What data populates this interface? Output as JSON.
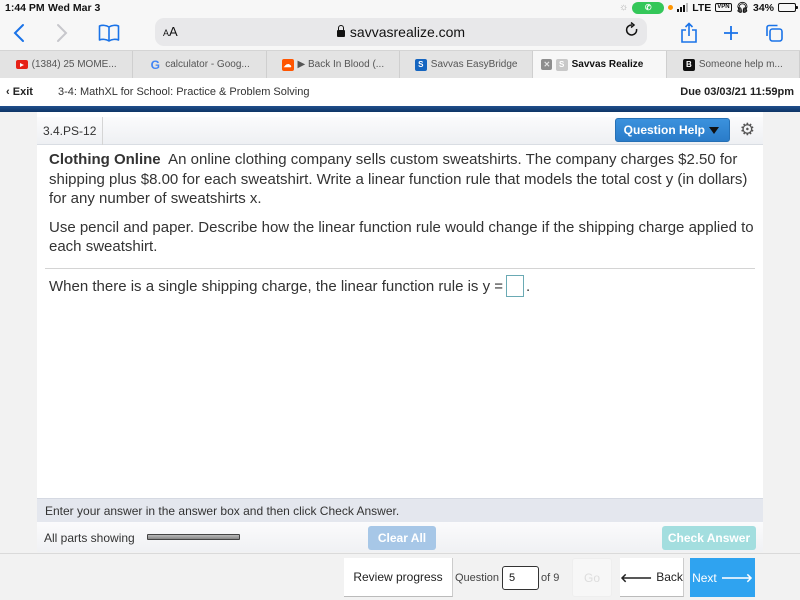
{
  "status_bar": {
    "time": "1:44 PM",
    "date": "Wed Mar 3",
    "network": "LTE",
    "vpn_label": "VPN",
    "battery_percent_label": "34%",
    "battery_level": 0.34,
    "call_icon": "phone-icon"
  },
  "browser": {
    "text_size_label": "AA",
    "url": "savvasrealize.com",
    "icons": {
      "back": "chevron-left-icon",
      "forward": "chevron-right-icon",
      "bookmarks": "book-icon",
      "reload": "reload-icon",
      "share": "share-icon",
      "new_tab": "plus-icon",
      "tabs": "tabs-icon"
    },
    "tabs": [
      {
        "label": "(1384) 25 MOME...",
        "icon": "youtube-icon",
        "active": false
      },
      {
        "label": "calculator - Goog...",
        "icon": "google-icon",
        "active": false
      },
      {
        "label": "▶ Back In Blood (...",
        "icon": "soundcloud-icon",
        "active": false
      },
      {
        "label": "Savvas EasyBridge",
        "icon": "savvas-icon",
        "active": false
      },
      {
        "label": "Savvas Realize",
        "icon": "savvas-gray-icon",
        "active": true
      },
      {
        "label": "Someone help m...",
        "icon": "brainly-icon",
        "active": false
      }
    ]
  },
  "assignment": {
    "exit_label": "Exit",
    "title": "3-4: MathXL for School: Practice & Problem Solving",
    "due": "Due 03/03/21 11:59pm"
  },
  "question": {
    "id": "3.4.PS-12",
    "help_label": "Question Help",
    "heading": "Clothing Online",
    "prompt": "An online clothing company sells custom sweatshirts. The company charges $2.50 for shipping plus $8.00 for each sweatshirt. Write a linear function rule that models the total cost y (in dollars) for any number of sweatshirts x.",
    "instructions": "Use pencil and paper. Describe how the linear function rule would change if the shipping charge applied to each sweatshirt.",
    "answer_prefix": "When there is a single shipping charge, the linear function rule is y =",
    "answer_suffix": ".",
    "answer_value": ""
  },
  "answer_bar": {
    "instruction": "Enter your answer in the answer box and then click Check Answer.",
    "parts_label": "All parts showing",
    "clear_all_label": "Clear All",
    "check_answer_label": "Check Answer"
  },
  "footer": {
    "review_label": "Review progress",
    "question_label": "Question",
    "question_number": "5",
    "of_label": "of 9",
    "go_label": "Go",
    "back_label": "Back",
    "next_label": "Next"
  }
}
